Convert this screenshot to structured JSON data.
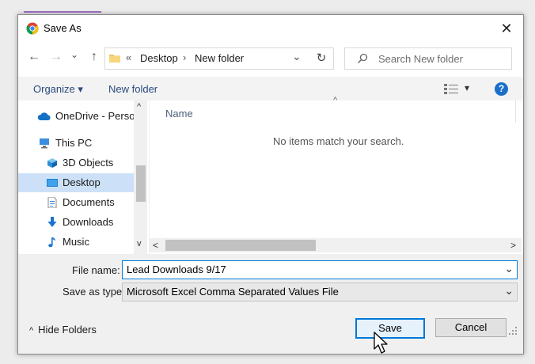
{
  "window": {
    "title": "Save As",
    "close_glyph": "✕",
    "icon": "chrome-icon"
  },
  "nav": {
    "back_glyph": "←",
    "forward_glyph": "→",
    "recent_glyph": "⌄",
    "up_glyph": "↑",
    "breadcrumb_prefix": "«",
    "breadcrumb": [
      "Desktop",
      "New folder"
    ],
    "breadcrumb_sep": "›",
    "address_dropdown_glyph": "⌄",
    "refresh_glyph": "↻",
    "search_placeholder": "Search New folder"
  },
  "toolbar": {
    "organize_label": "Organize ▾",
    "new_folder_label": "New folder",
    "view_dropdown_glyph": "▾",
    "help_glyph": "?"
  },
  "sidebar": {
    "items": [
      {
        "label": "OneDrive - Person",
        "icon": "cloud-icon",
        "selected": false
      },
      {
        "label": "This PC",
        "icon": "computer-icon",
        "selected": false
      },
      {
        "label": "3D Objects",
        "icon": "cube-icon",
        "selected": false
      },
      {
        "label": "Desktop",
        "icon": "desktop-icon",
        "selected": true
      },
      {
        "label": "Documents",
        "icon": "document-icon",
        "selected": false
      },
      {
        "label": "Downloads",
        "icon": "download-icon",
        "selected": false
      },
      {
        "label": "Music",
        "icon": "music-icon",
        "selected": false
      }
    ],
    "scroll_up_glyph": "^",
    "scroll_down_glyph": "v"
  },
  "filelist": {
    "column_name": "Name",
    "sort_glyph": "^",
    "empty_message": "No items match your search.",
    "scroll_left_glyph": "<",
    "scroll_right_glyph": ">"
  },
  "form": {
    "file_name_label": "File name:",
    "file_name_value": "Lead Downloads 9/17",
    "save_type_label": "Save as type:",
    "save_type_value": "Microsoft Excel Comma Separated Values File",
    "dropdown_glyph": "⌄"
  },
  "footer": {
    "hide_folders_label": "Hide Folders",
    "hide_folders_glyph": "^",
    "save_label": "Save",
    "cancel_label": "Cancel"
  },
  "colors": {
    "accent": "#0078d7",
    "selected_bg": "#cce1f7",
    "link_text": "#2a4a7f"
  }
}
